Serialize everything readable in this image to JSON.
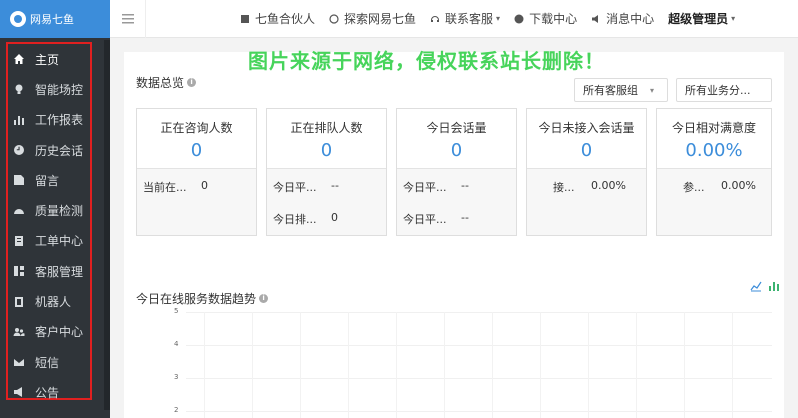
{
  "logo": {
    "text": "网易七鱼"
  },
  "sidebar": {
    "items": [
      {
        "label": "主页",
        "icon": "home-icon"
      },
      {
        "label": "智能场控",
        "icon": "lightbulb-icon"
      },
      {
        "label": "工作报表",
        "icon": "bar-chart-icon"
      },
      {
        "label": "历史会话",
        "icon": "clock-icon"
      },
      {
        "label": "留言",
        "icon": "edit-icon"
      },
      {
        "label": "质量检测",
        "icon": "dashboard-icon"
      },
      {
        "label": "工单中心",
        "icon": "ticket-icon"
      },
      {
        "label": "客服管理",
        "icon": "grid-icon"
      },
      {
        "label": "机器人",
        "icon": "robot-icon"
      },
      {
        "label": "客户中心",
        "icon": "users-icon"
      },
      {
        "label": "短信",
        "icon": "envelope-icon"
      },
      {
        "label": "公告",
        "icon": "megaphone-icon"
      }
    ]
  },
  "topbar": {
    "partner": "七鱼合伙人",
    "explore": "探索网易七鱼",
    "contact": "联系客服",
    "download": "下载中心",
    "messages": "消息中心",
    "admin": "超级管理员"
  },
  "watermark": "图片来源于网络，侵权联系站长删除！",
  "overview": {
    "title": "数据总览",
    "group_select": "所有客服组",
    "business_select": "所有业务分..."
  },
  "cards": [
    {
      "title": "正在咨询人数",
      "value": "0",
      "rows": [
        {
          "k": "当前在...",
          "v": "0"
        }
      ]
    },
    {
      "title": "正在排队人数",
      "value": "0",
      "rows": [
        {
          "k": "今日平...",
          "v": "--"
        },
        {
          "k": "今日排...",
          "v": "0"
        }
      ]
    },
    {
      "title": "今日会话量",
      "value": "0",
      "rows": [
        {
          "k": "今日平...",
          "v": "--"
        },
        {
          "k": "今日平...",
          "v": "--"
        }
      ]
    },
    {
      "title": "今日未接入会话量",
      "value": "0",
      "rows": [
        {
          "k": "接...",
          "v": "0.00%"
        }
      ]
    },
    {
      "title": "今日相对满意度",
      "value": "0.00%",
      "rows": [
        {
          "k": "参...",
          "v": "0.00%"
        }
      ]
    }
  ],
  "trend": {
    "title": "今日在线服务数据趋势"
  },
  "chart_data": {
    "type": "line",
    "title": "",
    "ylim": [
      2,
      5
    ],
    "yticks": [
      "5",
      "4",
      "3",
      "2"
    ],
    "series": []
  },
  "colors": {
    "accent": "#3c8dda",
    "sidebar": "#2f3439",
    "highlight_border": "#e02020",
    "watermark": "#34d04a"
  }
}
